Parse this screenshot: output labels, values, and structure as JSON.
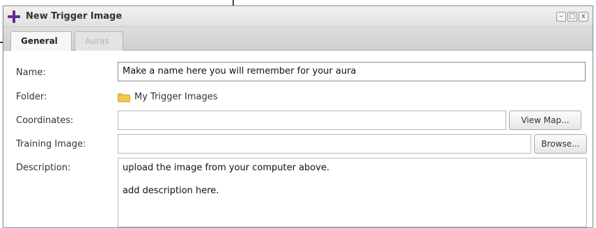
{
  "window": {
    "title": "New Trigger Image",
    "controls": {
      "minimize_icon": "minimize-icon",
      "maximize_icon": "maximize-icon",
      "close_icon": "close-icon",
      "minimize": "–",
      "maximize": "□",
      "close": "x"
    }
  },
  "tabs": [
    {
      "label": "General",
      "active": true
    },
    {
      "label": "Auras",
      "active": false
    }
  ],
  "form": {
    "name": {
      "label": "Name:",
      "value": "Make a name here you will remember for your aura"
    },
    "folder": {
      "label": "Folder:",
      "value": "My Trigger Images",
      "icon": "folder-icon"
    },
    "coordinates": {
      "label": "Coordinates:",
      "value": "",
      "button": "View Map..."
    },
    "training_image": {
      "label": "Training Image:",
      "value": "",
      "button": "Browse..."
    },
    "description": {
      "label": "Description:",
      "lines": [
        "upload the image from your computer above.",
        "add description here."
      ]
    }
  },
  "colors": {
    "accent_plus": "#6a2b8a",
    "folder": "#f3c74a"
  }
}
